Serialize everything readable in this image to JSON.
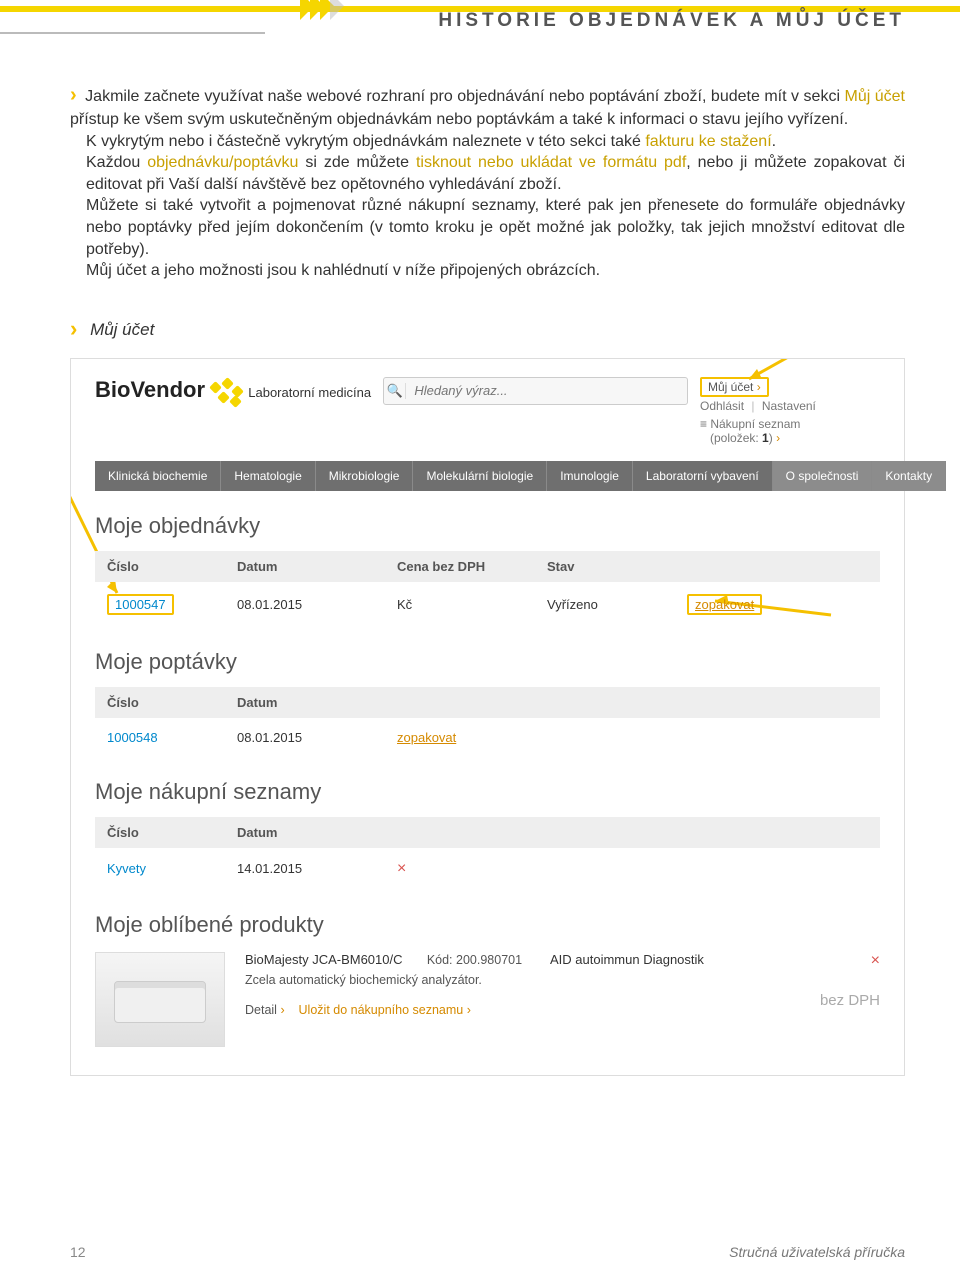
{
  "header": {
    "title": "HISTORIE OBJEDNÁVEK A MŮJ ÚČET"
  },
  "intro": {
    "p1_a": "Jakmile začnete využívat naše webové rozhraní pro objednávání nebo poptávání zboží, budete mít v sekci ",
    "p1_hl1": "Můj účet",
    "p1_b": " přístup ke všem svým uskutečněným objednávkám nebo poptávkám a také k informaci o stavu jejího vyřízení.",
    "p2_a": "K vykrytým nebo i částečně vykrytým objednávkám naleznete v této sekci také ",
    "p2_hl": "fakturu ke stažení",
    "p2_b": ".",
    "p3_a": "Každou ",
    "p3_hl1": "objednávku/poptávku",
    "p3_b": " si zde můžete ",
    "p3_hl2": "tisknout nebo ukládat ve formátu pdf",
    "p3_c": ", nebo ji můžete zopakovat či editovat při Vaší další návštěvě bez opětovného vyhledávání zboží.",
    "p4": "Můžete si také vytvořit a pojmenovat různé nákupní seznamy, které pak jen přenesete do formuláře objednávky nebo poptávky před jejím dokončením (v tomto kroku je opět možné jak položky, tak jejich množství editovat dle potřeby).",
    "p5": "Můj účet a jeho možnosti jsou k nahlédnutí v níže připojených obrázcích."
  },
  "caption": "Můj účet",
  "mock": {
    "logo_text": "BioVendor",
    "logo_sub": "Laboratorní medicína",
    "search_placeholder": "Hledaný výraz...",
    "account": {
      "my_account": "Můj účet",
      "logout": "Odhlásit",
      "settings": "Nastavení",
      "cart_label": "Nákupní seznam",
      "cart_count_label": "(položek: ",
      "cart_count": "1",
      "cart_count_close": ")"
    },
    "menu": [
      "Klinická biochemie",
      "Hematologie",
      "Mikrobiologie",
      "Molekulární biologie",
      "Imunologie",
      "Laboratorní vybavení",
      "O společnosti",
      "Kontakty"
    ],
    "orders": {
      "title": "Moje objednávky",
      "cols": {
        "c1": "Číslo",
        "c2": "Datum",
        "c3": "Cena bez DPH",
        "c4": "Stav"
      },
      "row": {
        "num": "1000547",
        "date": "08.01.2015",
        "price": "Kč",
        "status": "Vyřízeno",
        "action": "zopakovat"
      }
    },
    "inquiries": {
      "title": "Moje poptávky",
      "cols": {
        "c1": "Číslo",
        "c2": "Datum"
      },
      "row": {
        "num": "1000548",
        "date": "08.01.2015",
        "action": "zopakovat"
      }
    },
    "lists": {
      "title": "Moje nákupní seznamy",
      "cols": {
        "c1": "Číslo",
        "c2": "Datum"
      },
      "row": {
        "name": "Kyvety",
        "date": "14.01.2015"
      }
    },
    "favs": {
      "title": "Moje oblíbené produkty",
      "product": "BioMajesty JCA-BM6010/C",
      "code_label": "Kód:",
      "code": "200.980701",
      "brand": "AID autoimmun Diagnostik",
      "desc": "Zcela automatický biochemický analyzátor.",
      "detail": "Detail",
      "save": "Uložit do nákupního seznamu",
      "price": "bez DPH"
    }
  },
  "footer": {
    "page": "12",
    "guide": "Stručná uživatelská příručka"
  }
}
